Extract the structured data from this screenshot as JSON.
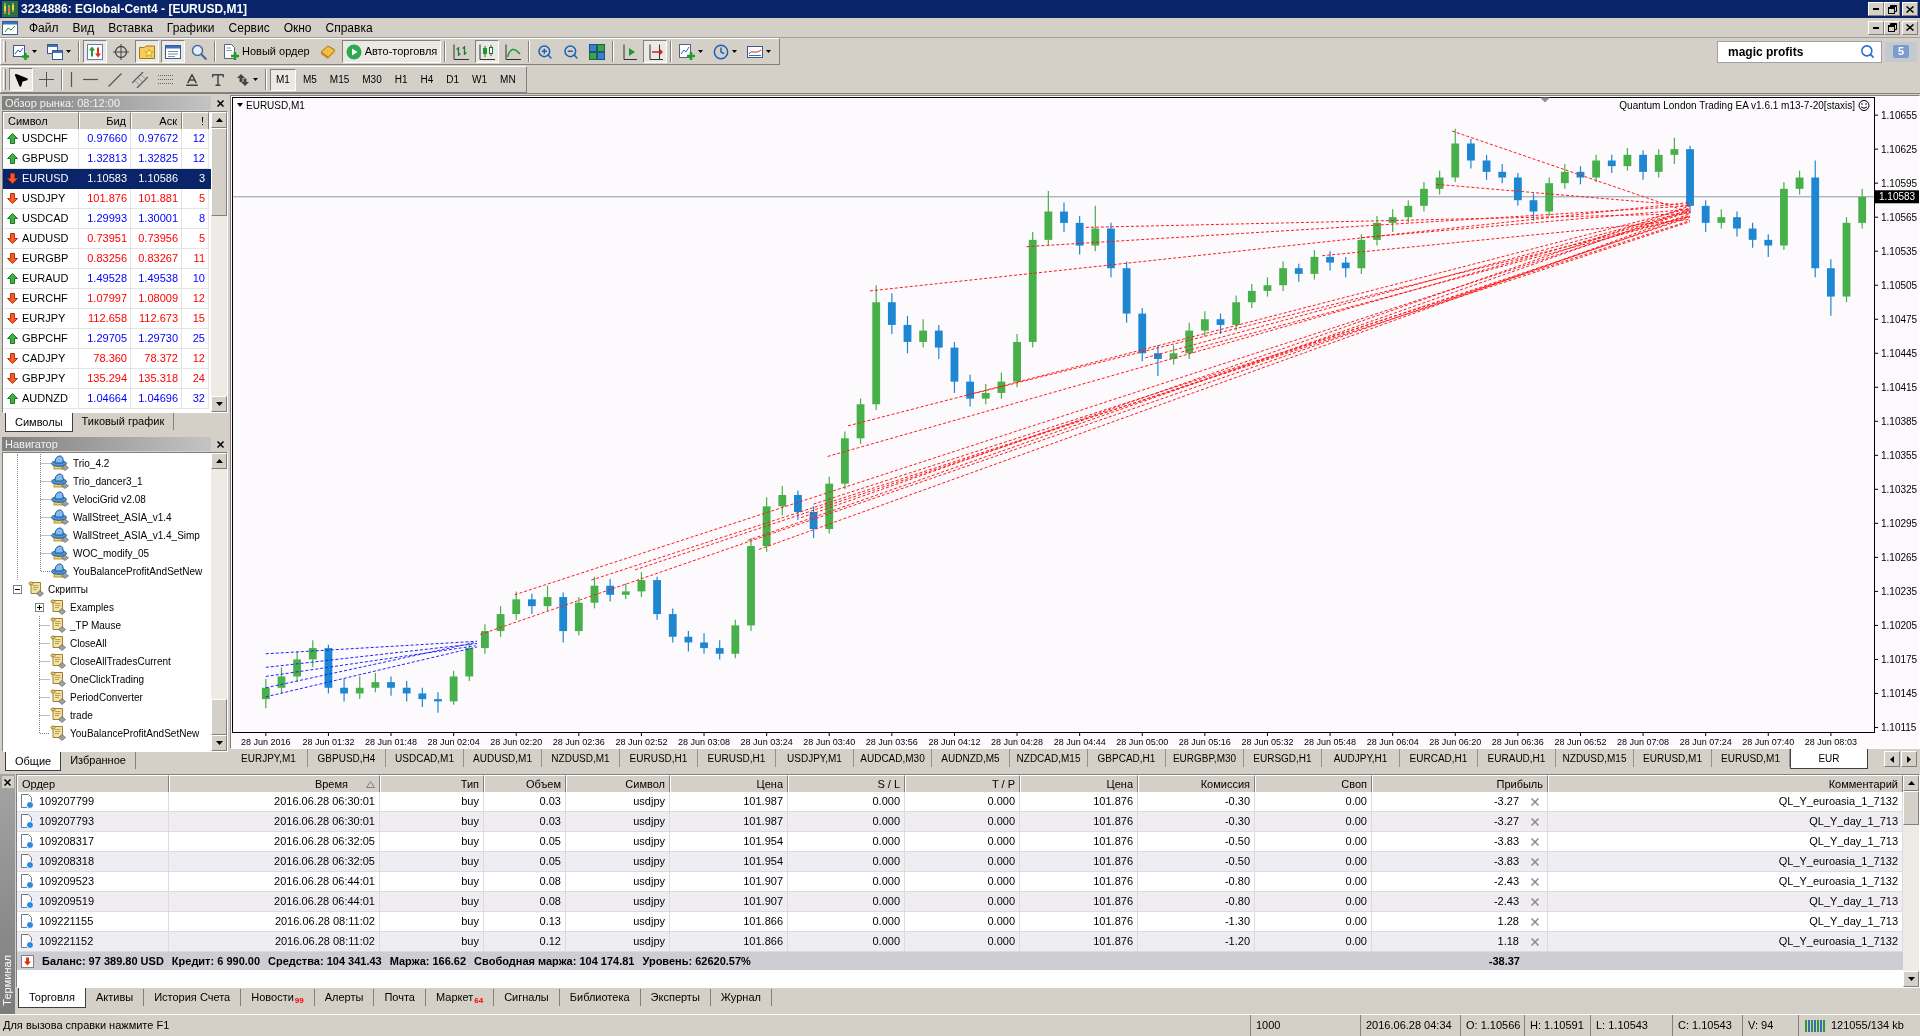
{
  "window": {
    "title": "3234886: EGlobal-Cent4 - [EURUSD,M1]"
  },
  "menu": [
    "Файл",
    "Вид",
    "Вставка",
    "Графики",
    "Сервис",
    "Окно",
    "Справка"
  ],
  "toolbar_groups": [
    [
      {
        "pressed": false,
        "dropdown": true
      },
      {
        "pressed": false,
        "dropdown": true
      }
    ],
    [
      {
        "pressed": true
      },
      {
        "pressed": false
      },
      {
        "pressed": true
      },
      {
        "pressed": true
      },
      {
        "pressed": false
      }
    ],
    [
      {
        "label": "Новый ордер",
        "pressed": false
      },
      {
        "pressed": false
      },
      {
        "label": "Авто-торговля",
        "pressed": true
      }
    ],
    [
      {
        "pressed": false
      },
      {
        "pressed": true
      },
      {
        "pressed": false
      }
    ],
    [
      {
        "pressed": false
      },
      {
        "pressed": false
      },
      {
        "pressed": false
      }
    ],
    [
      {
        "pressed": false
      },
      {
        "pressed": true
      }
    ],
    [
      {
        "pressed": false,
        "dropdown": true
      },
      {
        "pressed": false,
        "dropdown": true
      },
      {
        "pressed": false,
        "dropdown": true
      }
    ]
  ],
  "search": {
    "value": "magic profits"
  },
  "messages": {
    "count": "5"
  },
  "drawing_tools": [
    [
      {
        "pressed": true
      },
      {
        "pressed": false
      }
    ],
    [
      {
        "pressed": false
      },
      {
        "pressed": false
      },
      {
        "pressed": false
      },
      {
        "pressed": false
      },
      {
        "pressed": false
      },
      {
        "pressed": false
      },
      {
        "pressed": false
      },
      {
        "pressed": false,
        "dropdown": true
      }
    ]
  ],
  "timeframes": [
    {
      "label": "M1",
      "selected": true
    },
    {
      "label": "M5",
      "selected": false
    },
    {
      "label": "M15",
      "selected": false
    },
    {
      "label": "M30",
      "selected": false
    },
    {
      "label": "H1",
      "selected": false
    },
    {
      "label": "H4",
      "selected": false
    },
    {
      "label": "D1",
      "selected": false
    },
    {
      "label": "W1",
      "selected": false
    },
    {
      "label": "MN",
      "selected": false
    }
  ],
  "market_watch": {
    "title": "Обзор рынка: 08:12:00",
    "columns": [
      "Символ",
      "Бид",
      "Аск",
      "!"
    ],
    "rows": [
      {
        "symbol": "USDCHF",
        "bid": "0.97660",
        "ask": "0.97672",
        "spread": "12",
        "rising": true,
        "selected": false
      },
      {
        "symbol": "GBPUSD",
        "bid": "1.32813",
        "ask": "1.32825",
        "spread": "12",
        "rising": true,
        "selected": false
      },
      {
        "symbol": "EURUSD",
        "bid": "1.10583",
        "ask": "1.10586",
        "spread": "3",
        "rising": false,
        "selected": true
      },
      {
        "symbol": "USDJPY",
        "bid": "101.876",
        "ask": "101.881",
        "spread": "5",
        "rising": false,
        "selected": false
      },
      {
        "symbol": "USDCAD",
        "bid": "1.29993",
        "ask": "1.30001",
        "spread": "8",
        "rising": true,
        "selected": false
      },
      {
        "symbol": "AUDUSD",
        "bid": "0.73951",
        "ask": "0.73956",
        "spread": "5",
        "rising": false,
        "selected": false
      },
      {
        "symbol": "EURGBP",
        "bid": "0.83256",
        "ask": "0.83267",
        "spread": "11",
        "rising": false,
        "selected": false
      },
      {
        "symbol": "EURAUD",
        "bid": "1.49528",
        "ask": "1.49538",
        "spread": "10",
        "rising": true,
        "selected": false
      },
      {
        "symbol": "EURCHF",
        "bid": "1.07997",
        "ask": "1.08009",
        "spread": "12",
        "rising": false,
        "selected": false
      },
      {
        "symbol": "EURJPY",
        "bid": "112.658",
        "ask": "112.673",
        "spread": "15",
        "rising": false,
        "selected": false
      },
      {
        "symbol": "GBPCHF",
        "bid": "1.29705",
        "ask": "1.29730",
        "spread": "25",
        "rising": true,
        "selected": false
      },
      {
        "symbol": "CADJPY",
        "bid": "78.360",
        "ask": "78.372",
        "spread": "12",
        "rising": false,
        "selected": false
      },
      {
        "symbol": "GBPJPY",
        "bid": "135.294",
        "ask": "135.318",
        "spread": "24",
        "rising": false,
        "selected": false
      },
      {
        "symbol": "AUDNZD",
        "bid": "1.04664",
        "ask": "1.04696",
        "spread": "32",
        "rising": true,
        "selected": false
      }
    ],
    "tabs": [
      {
        "label": "Символы",
        "selected": true
      },
      {
        "label": "Тиковый график",
        "selected": false
      }
    ]
  },
  "navigator": {
    "title": "Навигатор",
    "tree": [
      {
        "children": [
          {
            "label": "Trio_4.2",
            "kind": "expert"
          },
          {
            "label": "Trio_dancer3_1",
            "kind": "expert"
          },
          {
            "label": "VelociGrid v2.08",
            "kind": "expert"
          },
          {
            "label": "WallStreet_ASIA_v1.4",
            "kind": "expert"
          },
          {
            "label": "WallStreet_ASIA_v1.4_Simp",
            "kind": "expert"
          },
          {
            "label": "WOC_modify_05",
            "kind": "expert"
          },
          {
            "label": "YouBalanceProfitAndSetNew",
            "kind": "expert"
          }
        ]
      },
      {
        "label": "Скрипты",
        "kind": "script",
        "expanded": true,
        "children": [
          {
            "label": "Examples",
            "kind": "script",
            "expanded": false
          },
          {
            "label": "_TP Mause",
            "kind": "script"
          },
          {
            "label": "CloseAll",
            "kind": "script"
          },
          {
            "label": "CloseAllTradesCurrent",
            "kind": "script"
          },
          {
            "label": "OneClickTrading",
            "kind": "script"
          },
          {
            "label": "PeriodConverter",
            "kind": "script"
          },
          {
            "label": "trade",
            "kind": "script"
          },
          {
            "label": "YouBalanceProfitAndSetNew",
            "kind": "script"
          }
        ]
      }
    ],
    "tabs": [
      {
        "label": "Общие",
        "selected": true
      },
      {
        "label": "Избранное",
        "selected": false
      }
    ]
  },
  "chart": {
    "expert_label": "Quantum London Trading EA v1.6.1 m13-7-20[staxis]",
    "chart_data": [
      {
        "type": "candlestick",
        "title": "EURUSD,M1",
        "categories": [
          "28 Jun 2016",
          null,
          null,
          null,
          "28 Jun 01:32",
          null,
          null,
          null,
          "28 Jun 01:48",
          null,
          null,
          null,
          "28 Jun 02:04",
          null,
          null,
          null,
          "28 Jun 02:20",
          null,
          null,
          null,
          "28 Jun 02:36",
          null,
          null,
          null,
          "28 Jun 02:52",
          null,
          null,
          null,
          "28 Jun 03:08",
          null,
          null,
          null,
          "28 Jun 03:24",
          null,
          null,
          null,
          "28 Jun 03:40",
          null,
          null,
          null,
          "28 Jun 03:56",
          null,
          null,
          null,
          "28 Jun 04:12",
          null,
          null,
          null,
          "28 Jun 04:28",
          null,
          null,
          null,
          "28 Jun 04:44",
          null,
          null,
          null,
          "28 Jun 05:00",
          null,
          null,
          null,
          "28 Jun 05:16",
          null,
          null,
          null,
          "28 Jun 05:32",
          null,
          null,
          null,
          "28 Jun 05:48",
          null,
          null,
          null,
          "28 Jun 06:04",
          null,
          null,
          null,
          "28 Jun 06:20",
          null,
          null,
          null,
          "28 Jun 06:36",
          null,
          null,
          null,
          "28 Jun 06:52",
          null,
          null,
          null,
          "28 Jun 07:08",
          null,
          null,
          null,
          "28 Jun 07:24",
          null,
          null,
          null,
          "28 Jun 07:40",
          null,
          null,
          null,
          "28 Jun 08:03",
          null,
          null
        ],
        "ohlc": [
          [
            1.1014,
            1.10158,
            1.10132,
            1.1015
          ],
          [
            1.1015,
            1.10168,
            1.10145,
            1.1016
          ],
          [
            1.1016,
            1.10182,
            1.10155,
            1.10175
          ],
          [
            1.10175,
            1.10192,
            1.10168,
            1.10185
          ],
          [
            1.10185,
            1.10188,
            1.10145,
            1.1015
          ],
          [
            1.1015,
            1.10158,
            1.10138,
            1.10145
          ],
          [
            1.10145,
            1.1016,
            1.1014,
            1.1015
          ],
          [
            1.1015,
            1.10163,
            1.10146,
            1.10155
          ],
          [
            1.10155,
            1.1016,
            1.10143,
            1.1015
          ],
          [
            1.1015,
            1.10156,
            1.10138,
            1.10145
          ],
          [
            1.10145,
            1.1015,
            1.10133,
            1.1014
          ],
          [
            1.1014,
            1.10146,
            1.10128,
            1.10138
          ],
          [
            1.10138,
            1.10165,
            1.10135,
            1.1016
          ],
          [
            1.1016,
            1.1019,
            1.10156,
            1.10185
          ],
          [
            1.10185,
            1.10206,
            1.1018,
            1.102
          ],
          [
            1.102,
            1.10222,
            1.10195,
            1.10215
          ],
          [
            1.10215,
            1.10235,
            1.1021,
            1.10228
          ],
          [
            1.10228,
            1.10233,
            1.10215,
            1.10222
          ],
          [
            1.10222,
            1.1024,
            1.10218,
            1.1023
          ],
          [
            1.1023,
            1.10234,
            1.1019,
            1.102
          ],
          [
            1.102,
            1.1023,
            1.10196,
            1.10225
          ],
          [
            1.10225,
            1.10248,
            1.1022,
            1.1024
          ],
          [
            1.1024,
            1.10246,
            1.10226,
            1.10232
          ],
          [
            1.10232,
            1.10242,
            1.10228,
            1.10235
          ],
          [
            1.10235,
            1.10252,
            1.1023,
            1.10245
          ],
          [
            1.10245,
            1.10248,
            1.1021,
            1.10215
          ],
          [
            1.10215,
            1.1022,
            1.1019,
            1.10195
          ],
          [
            1.10195,
            1.102,
            1.10182,
            1.1019
          ],
          [
            1.1019,
            1.10198,
            1.1018,
            1.10185
          ],
          [
            1.10185,
            1.10192,
            1.10175,
            1.1018
          ],
          [
            1.1018,
            1.1021,
            1.10176,
            1.10205
          ],
          [
            1.10205,
            1.10282,
            1.102,
            1.10275
          ],
          [
            1.10275,
            1.10318,
            1.1027,
            1.1031
          ],
          [
            1.1031,
            1.10328,
            1.10302,
            1.1032
          ],
          [
            1.1032,
            1.10324,
            1.10298,
            1.10305
          ],
          [
            1.10305,
            1.1031,
            1.10282,
            1.1029
          ],
          [
            1.1029,
            1.10336,
            1.10286,
            1.1033
          ],
          [
            1.1033,
            1.10376,
            1.10325,
            1.1037
          ],
          [
            1.1037,
            1.10405,
            1.10365,
            1.104
          ],
          [
            1.104,
            1.10505,
            1.10395,
            1.1049
          ],
          [
            1.1049,
            1.10498,
            1.10462,
            1.1047
          ],
          [
            1.1047,
            1.10478,
            1.10445,
            1.10455
          ],
          [
            1.10455,
            1.10475,
            1.1045,
            1.10465
          ],
          [
            1.10465,
            1.1047,
            1.1044,
            1.1045
          ],
          [
            1.1045,
            1.10455,
            1.1041,
            1.1042
          ],
          [
            1.1042,
            1.10426,
            1.10398,
            1.10405
          ],
          [
            1.10405,
            1.10418,
            1.104,
            1.1041
          ],
          [
            1.1041,
            1.10428,
            1.10405,
            1.1042
          ],
          [
            1.1042,
            1.10462,
            1.10415,
            1.10455
          ],
          [
            1.10455,
            1.10552,
            1.1045,
            1.10545
          ],
          [
            1.10545,
            1.10588,
            1.1054,
            1.1057
          ],
          [
            1.1057,
            1.10578,
            1.10552,
            1.1056
          ],
          [
            1.1056,
            1.10566,
            1.10532,
            1.1054
          ],
          [
            1.1054,
            1.10575,
            1.10535,
            1.10555
          ],
          [
            1.10555,
            1.1056,
            1.10512,
            1.1052
          ],
          [
            1.1052,
            1.10526,
            1.10472,
            1.1048
          ],
          [
            1.1048,
            1.10485,
            1.10438,
            1.10445
          ],
          [
            1.10445,
            1.10452,
            1.10425,
            1.1044
          ],
          [
            1.1044,
            1.10452,
            1.10435,
            1.10445
          ],
          [
            1.10445,
            1.10472,
            1.1044,
            1.10465
          ],
          [
            1.10465,
            1.10482,
            1.1046,
            1.10475
          ],
          [
            1.10475,
            1.1048,
            1.10462,
            1.1047
          ],
          [
            1.1047,
            1.10496,
            1.10465,
            1.1049
          ],
          [
            1.1049,
            1.10506,
            1.10485,
            1.105
          ],
          [
            1.105,
            1.10512,
            1.10495,
            1.10505
          ],
          [
            1.10505,
            1.10526,
            1.105,
            1.1052
          ],
          [
            1.1052,
            1.10524,
            1.10508,
            1.10515
          ],
          [
            1.10515,
            1.10536,
            1.1051,
            1.1053
          ],
          [
            1.1053,
            1.10535,
            1.10518,
            1.10525
          ],
          [
            1.10525,
            1.1053,
            1.10512,
            1.1052
          ],
          [
            1.1052,
            1.1055,
            1.10515,
            1.10545
          ],
          [
            1.10545,
            1.10566,
            1.1054,
            1.1056
          ],
          [
            1.1056,
            1.10572,
            1.10552,
            1.10565
          ],
          [
            1.10565,
            1.1058,
            1.1056,
            1.10575
          ],
          [
            1.10575,
            1.10596,
            1.1057,
            1.1059
          ],
          [
            1.1059,
            1.10606,
            1.10585,
            1.106
          ],
          [
            1.106,
            1.10643,
            1.10596,
            1.1063
          ],
          [
            1.1063,
            1.10634,
            1.10608,
            1.10615
          ],
          [
            1.10615,
            1.1062,
            1.10598,
            1.10605
          ],
          [
            1.10605,
            1.10612,
            1.10595,
            1.106
          ],
          [
            1.106,
            1.10604,
            1.10575,
            1.1058
          ],
          [
            1.1058,
            1.10586,
            1.10562,
            1.1057
          ],
          [
            1.1057,
            1.106,
            1.10566,
            1.10595
          ],
          [
            1.10595,
            1.10612,
            1.1059,
            1.10605
          ],
          [
            1.10605,
            1.1061,
            1.10594,
            1.106
          ],
          [
            1.106,
            1.1062,
            1.10596,
            1.10615
          ],
          [
            1.10615,
            1.1062,
            1.10604,
            1.1061
          ],
          [
            1.1061,
            1.10626,
            1.10606,
            1.1062
          ],
          [
            1.1062,
            1.10624,
            1.10598,
            1.10605
          ],
          [
            1.10605,
            1.10625,
            1.106,
            1.1062
          ],
          [
            1.1062,
            1.10635,
            1.10612,
            1.10625
          ],
          [
            1.10625,
            1.10628,
            1.10568,
            1.10575
          ],
          [
            1.10575,
            1.1058,
            1.10552,
            1.1056
          ],
          [
            1.1056,
            1.10572,
            1.10555,
            1.10565
          ],
          [
            1.10565,
            1.1057,
            1.10548,
            1.10555
          ],
          [
            1.10555,
            1.1056,
            1.10538,
            1.10545
          ],
          [
            1.10545,
            1.1055,
            1.1053,
            1.1054
          ],
          [
            1.1054,
            1.10596,
            1.10536,
            1.1059
          ],
          [
            1.1059,
            1.10606,
            1.10585,
            1.106
          ],
          [
            1.106,
            1.10615,
            1.10512,
            1.1052
          ],
          [
            1.1052,
            1.10528,
            1.10478,
            1.10495
          ],
          [
            1.10495,
            1.10565,
            1.1049,
            1.1056
          ],
          [
            1.1056,
            1.1059,
            1.10555,
            1.10583
          ]
        ],
        "ylim": [
          1.10111,
          1.10671
        ],
        "yticks": [
          1.10115,
          1.10145,
          1.10175,
          1.10205,
          1.10235,
          1.10265,
          1.10295,
          1.10325,
          1.10355,
          1.10385,
          1.10415,
          1.10445,
          1.10475,
          1.10505,
          1.10535,
          1.10565,
          1.10595,
          1.10625,
          1.10655
        ],
        "ref_lines": [
          {
            "axis": "y",
            "value": 1.10583,
            "label": "1.10583",
            "color": "#8c9aa8"
          }
        ]
      }
    ]
  },
  "chart_tabs": [
    {
      "label": "EURJPY,M1",
      "selected": false
    },
    {
      "label": "GBPUSD,H4",
      "selected": false
    },
    {
      "label": "USDCAD,M1",
      "selected": false
    },
    {
      "label": "AUDUSD,M1",
      "selected": false
    },
    {
      "label": "NZDUSD,M1",
      "selected": false
    },
    {
      "label": "EURUSD,H1",
      "selected": false
    },
    {
      "label": "EURUSD,H1",
      "selected": false
    },
    {
      "label": "USDJPY,M1",
      "selected": false
    },
    {
      "label": "AUDCAD,M30",
      "selected": false
    },
    {
      "label": "AUDNZD,M5",
      "selected": false
    },
    {
      "label": "NZDCAD,M15",
      "selected": false
    },
    {
      "label": "GBPCAD,H1",
      "selected": false
    },
    {
      "label": "EURGBP,M30",
      "selected": false
    },
    {
      "label": "EURSGD,H1",
      "selected": false
    },
    {
      "label": "AUDJPY,H1",
      "selected": false
    },
    {
      "label": "EURCAD,H1",
      "selected": false
    },
    {
      "label": "EURAUD,H1",
      "selected": false
    },
    {
      "label": "NZDUSD,M15",
      "selected": false
    },
    {
      "label": "EURUSD,M1",
      "selected": false
    },
    {
      "label": "EURUSD,M1",
      "selected": false
    },
    {
      "label": "EUR",
      "selected": true
    }
  ],
  "terminal": {
    "title": "Терминал",
    "columns": [
      {
        "label": "Ордер",
        "sorted": false
      },
      {
        "label": "Время",
        "sorted": true
      },
      {
        "label": "Тип",
        "sorted": false
      },
      {
        "label": "Объем",
        "sorted": false
      },
      {
        "label": "Символ",
        "sorted": false
      },
      {
        "label": "Цена",
        "sorted": false
      },
      {
        "label": "S / L",
        "sorted": false
      },
      {
        "label": "T / P",
        "sorted": false
      },
      {
        "label": "Цена",
        "sorted": false
      },
      {
        "label": "Комиссия",
        "sorted": false
      },
      {
        "label": "Своп",
        "sorted": false
      },
      {
        "label": "Прибыль",
        "sorted": false
      },
      {
        "label": "Комментарий",
        "sorted": false
      }
    ],
    "rows": [
      [
        "109207799",
        "2016.06.28 06:30:01",
        "buy",
        "0.03",
        "usdjpy",
        "101.987",
        "0.000",
        "0.000",
        "101.876",
        "-0.30",
        "0.00",
        "-3.27",
        "QL_Y_euroasia_1_7132"
      ],
      [
        "109207793",
        "2016.06.28 06:30:01",
        "buy",
        "0.03",
        "usdjpy",
        "101.987",
        "0.000",
        "0.000",
        "101.876",
        "-0.30",
        "0.00",
        "-3.27",
        "QL_Y_day_1_713"
      ],
      [
        "109208317",
        "2016.06.28 06:32:05",
        "buy",
        "0.05",
        "usdjpy",
        "101.954",
        "0.000",
        "0.000",
        "101.876",
        "-0.50",
        "0.00",
        "-3.83",
        "QL_Y_day_1_713"
      ],
      [
        "109208318",
        "2016.06.28 06:32:05",
        "buy",
        "0.05",
        "usdjpy",
        "101.954",
        "0.000",
        "0.000",
        "101.876",
        "-0.50",
        "0.00",
        "-3.83",
        "QL_Y_euroasia_1_7132"
      ],
      [
        "109209523",
        "2016.06.28 06:44:01",
        "buy",
        "0.08",
        "usdjpy",
        "101.907",
        "0.000",
        "0.000",
        "101.876",
        "-0.80",
        "0.00",
        "-2.43",
        "QL_Y_euroasia_1_7132"
      ],
      [
        "109209519",
        "2016.06.28 06:44:01",
        "buy",
        "0.08",
        "usdjpy",
        "101.907",
        "0.000",
        "0.000",
        "101.876",
        "-0.80",
        "0.00",
        "-2.43",
        "QL_Y_day_1_713"
      ],
      [
        "109221155",
        "2016.06.28 08:11:02",
        "buy",
        "0.13",
        "usdjpy",
        "101.866",
        "0.000",
        "0.000",
        "101.876",
        "-1.30",
        "0.00",
        "1.28",
        "QL_Y_day_1_713"
      ],
      [
        "109221152",
        "2016.06.28 08:11:02",
        "buy",
        "0.12",
        "usdjpy",
        "101.866",
        "0.000",
        "0.000",
        "101.876",
        "-1.20",
        "0.00",
        "1.18",
        "QL_Y_euroasia_1_7132"
      ]
    ],
    "summary": [
      "Баланс: 97 389.80 USD",
      "Кредит: 6 990.00",
      "Средства: 104 341.43",
      "Маржа: 166.62",
      "Свободная маржа: 104 174.81",
      "Уровень: 62620.57%"
    ],
    "total_profit": "-38.37",
    "tabs": [
      {
        "label": "Торговля",
        "selected": true
      },
      {
        "label": "Активы",
        "selected": false
      },
      {
        "label": "История Счета",
        "selected": false
      },
      {
        "label": "Новости",
        "badge": "99",
        "selected": false
      },
      {
        "label": "Алерты",
        "selected": false
      },
      {
        "label": "Почта",
        "selected": false
      },
      {
        "label": "Маркет",
        "badge": "64",
        "selected": false
      },
      {
        "label": "Сигналы",
        "selected": false
      },
      {
        "label": "Библиотека",
        "selected": false
      },
      {
        "label": "Эксперты",
        "selected": false
      },
      {
        "label": "Журнал",
        "selected": false
      }
    ]
  },
  "status_bar": {
    "help": "Для вызова справки нажмите F1",
    "segments": [
      "1000",
      "2016.06.28 04:34",
      "O: 1.10566",
      "H: 1.10591",
      "L: 1.10543",
      "C: 1.10543",
      "V: 94"
    ],
    "traffic": "121055/134 kb"
  }
}
